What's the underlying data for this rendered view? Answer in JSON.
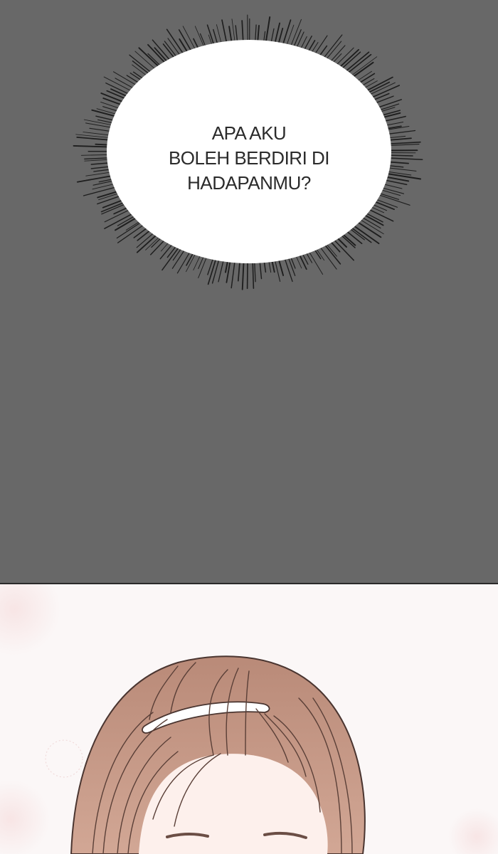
{
  "speech_bubble": {
    "lines": [
      "APA AKU",
      "BOLEH BERDIRI DI",
      "HADAPANMU?"
    ]
  },
  "colors": {
    "top_panel_background": "#686868",
    "bubble_fill": "#ffffff",
    "burst_lines": "#1e1e1e",
    "hair": "#c49a88",
    "headband": "#ffffff",
    "skin": "#fdf0ec",
    "bottom_panel_background": "#fbf7f7"
  }
}
